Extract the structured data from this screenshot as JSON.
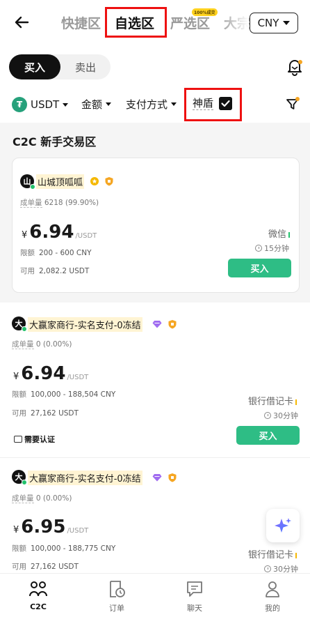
{
  "header": {
    "tabs": [
      {
        "label": "快捷区"
      },
      {
        "label": "自选区"
      },
      {
        "label": "严选区"
      },
      {
        "label": "大宗"
      }
    ],
    "tab_badge": "100%成交",
    "currency": "CNY"
  },
  "trade_toggle": {
    "buy": "买入",
    "sell": "卖出"
  },
  "filters": {
    "coin": "USDT",
    "amount": "金额",
    "payment": "支付方式",
    "shield": "神盾"
  },
  "section_title": "C2C 新手交易区",
  "listings": [
    {
      "avatar": "山",
      "name": "山城顶呱呱",
      "orders_label": "成单量",
      "orders_value": "6218 (99.90%)",
      "currency_symbol": "¥",
      "price": "6.94",
      "unit": "/USDT",
      "limit_label": "限额",
      "limit_value": "200 - 600 CNY",
      "available_label": "可用",
      "available_value": "2,082.2 USDT",
      "payment": "微信",
      "payment_color": "#22c16b",
      "time": "15分钟",
      "button": "买入"
    },
    {
      "avatar": "大",
      "name": "大赢家商行-实名支付-0冻结",
      "orders_label": "成单量",
      "orders_value": "0 (0.00%)",
      "currency_symbol": "¥",
      "price": "6.94",
      "unit": "/USDT",
      "limit_label": "限额",
      "limit_value": "100,000 - 188,504 CNY",
      "available_label": "可用",
      "available_value": "27,162 USDT",
      "payment": "银行借记卡",
      "payment_color": "#f5b800",
      "time": "30分钟",
      "verify": "需要认证",
      "button": "买入"
    },
    {
      "avatar": "大",
      "name": "大赢家商行-实名支付-0冻结",
      "orders_label": "成单量",
      "orders_value": "0 (0.00%)",
      "currency_symbol": "¥",
      "price": "6.95",
      "unit": "/USDT",
      "limit_label": "限额",
      "limit_value": "100,000 - 188,775 CNY",
      "available_label": "可用",
      "available_value": "27,162 USDT",
      "payment": "银行借记卡",
      "payment_color": "#f5b800",
      "time": "30分钟"
    }
  ],
  "bottom_nav": [
    {
      "label": "C2C",
      "icon": "people-icon"
    },
    {
      "label": "订单",
      "icon": "order-icon"
    },
    {
      "label": "聊天",
      "icon": "chat-icon"
    },
    {
      "label": "我的",
      "icon": "user-icon"
    }
  ],
  "colors": {
    "accent_green": "#2ebd85",
    "highlight_red": "#e11",
    "name_bg": "#fff4d3"
  }
}
